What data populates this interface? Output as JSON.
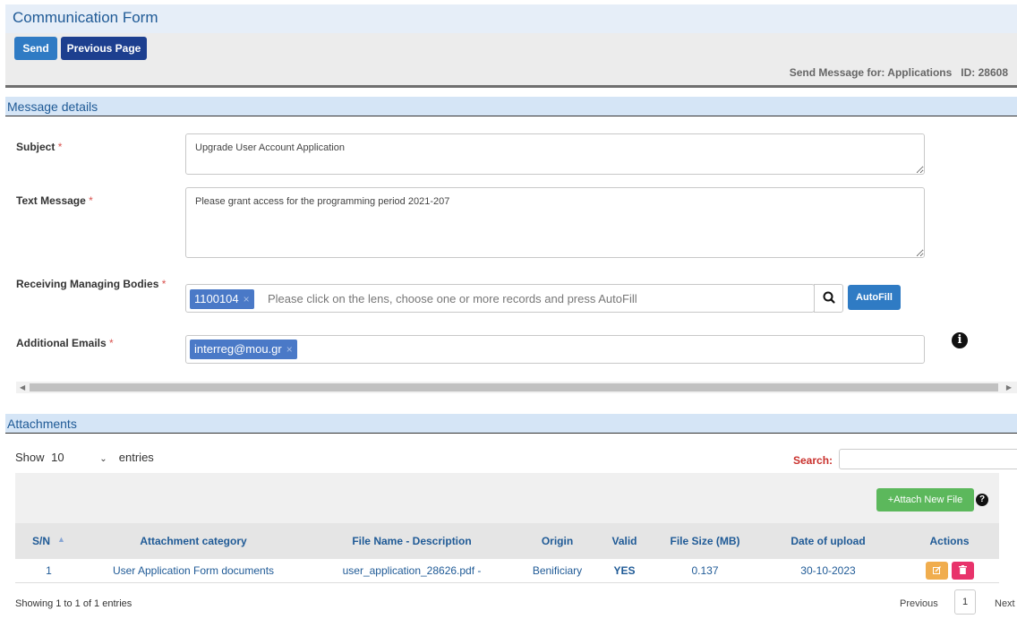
{
  "header": {
    "title": "Communication Form",
    "send_label": "Send",
    "previous_label": "Previous Page",
    "info": "Send Message for: Applications   ID: 28608"
  },
  "message_section": {
    "title": "Message details",
    "required_mark": "*",
    "subject_label": "Subject",
    "subject_value": "Upgrade User Account Application",
    "text_label": "Text Message",
    "text_value": "Please grant access for the programming period 2021-207",
    "bodies_label": "Receiving Managing Bodies",
    "bodies_tag": "1100104",
    "bodies_placeholder": "Please click on the lens, choose one or more records and press AutoFill",
    "autofill_label": "AutoFill",
    "emails_label": "Additional Emails",
    "emails_tag": "interreg@mou.gr",
    "tag_remove": "×"
  },
  "attachments": {
    "title": "Attachments",
    "show_label": "Show",
    "show_value": "10",
    "entries_label": "entries",
    "search_label": "Search:",
    "attach_label": "+Attach New File",
    "columns": [
      "S/N",
      "Attachment category",
      "File Name - Description",
      "Origin",
      "Valid",
      "File Size (MB)",
      "Date of upload",
      "Actions"
    ],
    "rows": [
      {
        "sn": "1",
        "category": "User Application Form documents",
        "file": "user_application_28626.pdf -",
        "origin": "Benificiary",
        "valid": "YES",
        "size": "0.137",
        "date": "30-10-2023"
      }
    ],
    "showing": "Showing 1 to 1 of 1 entries",
    "previous": "Previous",
    "page": "1",
    "next": "Next"
  },
  "colors": {
    "primary": "#2f7bc4",
    "dark_primary": "#1d3f8f",
    "tag": "#4a79c7",
    "success": "#5cb85c",
    "warning": "#f0ad4e",
    "danger": "#e8336b",
    "title_text": "#1f5a96"
  },
  "icons": [
    "search-icon",
    "info-icon",
    "help-icon",
    "edit-icon",
    "trash-icon",
    "sort-up-icon",
    "chevron-down-icon"
  ]
}
